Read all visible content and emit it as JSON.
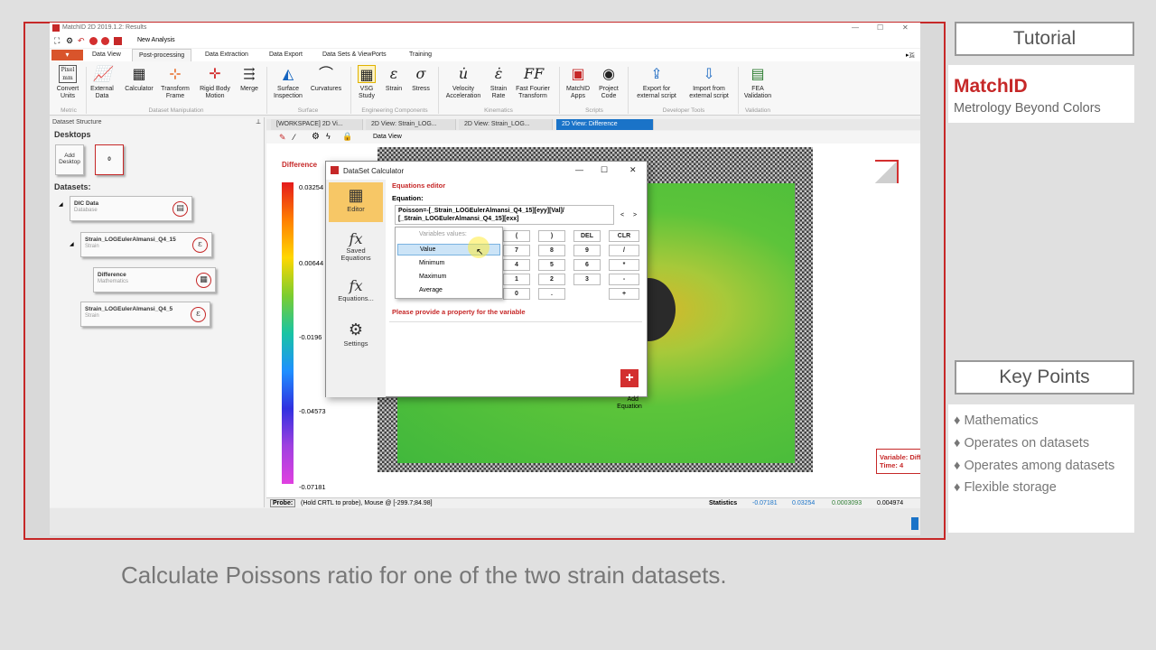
{
  "app": {
    "title": "MatchID 2D 2019.1.2: Results",
    "new_analysis": "New Analysis"
  },
  "tabs": [
    {
      "label": "Data View"
    },
    {
      "label": "Post-processing"
    },
    {
      "label": "Data Extraction"
    },
    {
      "label": "Data Export"
    },
    {
      "label": "Data Sets & ViewPorts"
    },
    {
      "label": "Training"
    }
  ],
  "ribbon": {
    "buttons": [
      {
        "label": "Convert\nUnits",
        "icon": "pixel-mm-icon"
      },
      {
        "label": "External\nData",
        "icon": "chart-icon"
      },
      {
        "label": "Calculator",
        "icon": "calculator-icon"
      },
      {
        "label": "Transform\nFrame",
        "icon": "axes-icon"
      },
      {
        "label": "Rigid Body\nMotion",
        "icon": "move-icon"
      },
      {
        "label": "Merge",
        "icon": "merge-icon"
      },
      {
        "label": "Surface\nInspection",
        "icon": "surface-icon"
      },
      {
        "label": "Curvatures",
        "icon": "curve-icon"
      },
      {
        "label": "VSG\nStudy",
        "icon": "grid-icon"
      },
      {
        "label": "Strain",
        "icon": "epsilon-icon"
      },
      {
        "label": "Stress",
        "icon": "sigma-icon"
      },
      {
        "label": "Velocity\nAcceleration",
        "icon": "u-dot-icon"
      },
      {
        "label": "Strain\nRate",
        "icon": "eps-dot-icon"
      },
      {
        "label": "Fast Fourier\nTransform",
        "icon": "fft-icon"
      },
      {
        "label": "MatchID\nApps",
        "icon": "apps-icon"
      },
      {
        "label": "Project\nCode",
        "icon": "eye-icon"
      },
      {
        "label": "Export for\nexternal script",
        "icon": "export-icon"
      },
      {
        "label": "Import from\nexternal script",
        "icon": "import-icon"
      },
      {
        "label": "FEA\nValidation",
        "icon": "fea-icon"
      }
    ],
    "groups": [
      "Metric",
      "Dataset Manipulation",
      "Surface",
      "Engineering Components",
      "Kinematics",
      "Scripts",
      "Developer Tools",
      "Validation"
    ]
  },
  "left": {
    "panel_title": "Dataset Structure",
    "desktops": "Desktops",
    "add_desktop": "Add\nDesktop",
    "desktop_0": "0",
    "datasets": "Datasets:",
    "items": [
      {
        "name": "DIC Data",
        "type": "Database"
      },
      {
        "name": "Strain_LOGEulerAlmansi_Q4_15",
        "type": "Strain"
      },
      {
        "name": "Difference",
        "type": "Mathematics"
      },
      {
        "name": "Strain_LOGEulerAlmansi_Q4_5",
        "type": "Strain"
      }
    ]
  },
  "doc_tabs": [
    {
      "label": "[WORKSPACE] 2D Vi..."
    },
    {
      "label": "2D View: Strain_LOG..."
    },
    {
      "label": "2D View: Strain_LOG..."
    },
    {
      "label": "2D View: Difference"
    }
  ],
  "toolbar2": {
    "data_view": "Data View"
  },
  "view": {
    "label": "Difference",
    "scale": [
      "0.03254",
      "0.00644",
      "-0.0196",
      "-0.04573",
      "-0.07181"
    ],
    "overlay_variable": "Variable: Difference",
    "overlay_time": "Time: 4"
  },
  "dialog": {
    "title": "DataSet Calculator",
    "section": "Equations editor",
    "equation_label": "Equation:",
    "equation": "Poisson=-[_Strain_LOGEulerAlmansi_Q4_15][eyy][Val]/\n[_Strain_LOGEulerAlmansi_Q4_15][exx]",
    "sidebar": [
      {
        "label": "Editor"
      },
      {
        "label": "Saved\nEquations"
      },
      {
        "label": "Equations..."
      },
      {
        "label": "Settings"
      }
    ],
    "dropdown": {
      "header": "Variables values:",
      "items": [
        "Value",
        "Minimum",
        "Maximum",
        "Average"
      ]
    },
    "keys": [
      "(",
      ")",
      "DEL",
      "CLR",
      "7",
      "8",
      "9",
      "/",
      "4",
      "5",
      "6",
      "*",
      "1",
      "2",
      "3",
      "-",
      "0",
      ".",
      "",
      "+"
    ],
    "error": "Please provide a property for the variable",
    "add_equation": "Add\nEquation"
  },
  "status": {
    "probe": "Probe:",
    "probe_text": "(Hold CRTL to probe), Mouse @ [-299.7;84.98]",
    "statistics": "Statistics",
    "min": "-0.07181",
    "max": "0.03254",
    "mean": "0.0003093",
    "sigma": "0.004974"
  },
  "right": {
    "tutorial": "Tutorial",
    "brand": "MatchID",
    "tagline": "Metrology Beyond Colors",
    "key_points": "Key Points",
    "points": [
      "Mathematics",
      "Operates on datasets",
      "Operates among datasets",
      "Flexible storage"
    ]
  },
  "caption": "Calculate Poissons ratio for one of the two strain datasets.",
  "colors": {
    "frame": "#c62828",
    "brand": "#c62828",
    "active_tab": "#1a73c8"
  }
}
